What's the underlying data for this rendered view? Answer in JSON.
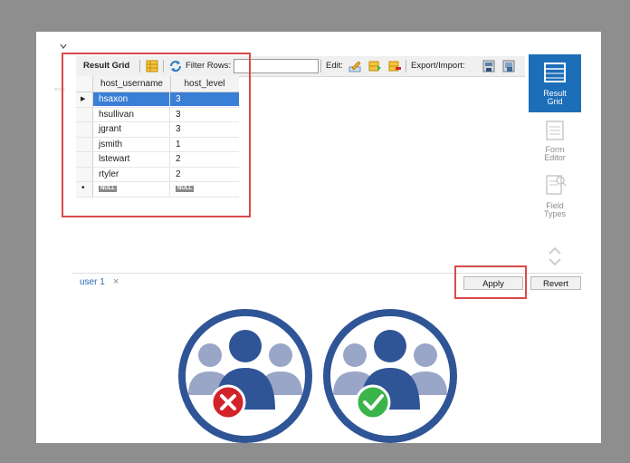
{
  "toolbar": {
    "result_grid": "Result Grid",
    "filter_rows": "Filter Rows:",
    "filter_value": "",
    "edit": "Edit:",
    "export_import": "Export/Import:"
  },
  "grid": {
    "columns": [
      "host_username",
      "host_level"
    ],
    "rows": [
      {
        "username": "hsaxon",
        "level": "3",
        "selected": true
      },
      {
        "username": "hsullivan",
        "level": "3"
      },
      {
        "username": "jgrant",
        "level": "3"
      },
      {
        "username": "jsmith",
        "level": "1"
      },
      {
        "username": "lstewart",
        "level": "2"
      },
      {
        "username": "rtyler",
        "level": "2"
      }
    ],
    "null_label": "NULL"
  },
  "side_panel": {
    "result_grid": [
      "Result",
      "Grid"
    ],
    "form_editor": [
      "Form",
      "Editor"
    ],
    "field_types": [
      "Field",
      "Types"
    ]
  },
  "bottom": {
    "tab_label": "user 1",
    "close_glyph": "×",
    "apply_label": "Apply",
    "revert_label": "Revert"
  },
  "icons": {
    "denied": "users-denied-icon",
    "approved": "users-approved-icon"
  },
  "colors": {
    "highlight_red": "#d84a4a",
    "selection_blue": "#3a7fd6",
    "panel_blue": "#1d6eb9",
    "people_dark": "#2f5597",
    "people_light": "#9aa6c8",
    "deny_red": "#d2232a",
    "approve_green": "#3bb54a"
  }
}
